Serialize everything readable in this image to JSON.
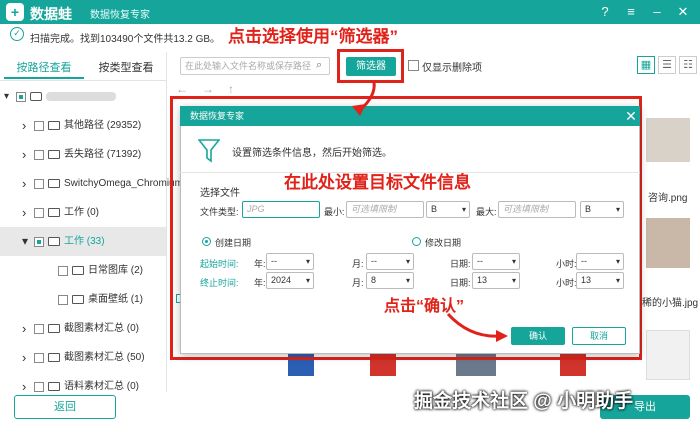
{
  "app": {
    "brand": "数据蛙",
    "product": "数据恢复专家",
    "accent": "#16a59a",
    "annotation_color": "#e0231a"
  },
  "status": {
    "text": "扫描完成。找到103490个文件共13.2 GB。"
  },
  "annotations": {
    "top": "点击选择使用“筛选器”",
    "middle": "在此处设置目标文件信息",
    "confirm": "点击“确认”"
  },
  "tabs": {
    "by_path": "按路径查看",
    "by_type": "按类型查看"
  },
  "toolbar": {
    "search_placeholder": "在此处输入文件名称或保存路径",
    "filter_label": "筛选器",
    "show_deleted_label": "仅显示删除项"
  },
  "tree": [
    {
      "label": "其他路径 (29352)",
      "expanded": false,
      "level": 1
    },
    {
      "label": "丢失路径 (71392)",
      "expanded": false,
      "level": 1
    },
    {
      "label": "SwitchyOmega_Chromium",
      "expanded": false,
      "level": 1
    },
    {
      "label": "工作 (0)",
      "expanded": false,
      "level": 1
    },
    {
      "label": "工作 (33)",
      "expanded": true,
      "level": 1,
      "selected": true
    },
    {
      "label": "日常图库 (2)",
      "level": 2
    },
    {
      "label": "桌面壁纸 (1)",
      "level": 2
    },
    {
      "label": "截图素材汇总 (0)",
      "level": 1
    },
    {
      "label": "截图素材汇总 (50)",
      "level": 1
    },
    {
      "label": "语料素材汇总 (0)",
      "level": 1
    }
  ],
  "right_labels": {
    "label1": "咨询.png",
    "label2": "稀的小猫.jpg"
  },
  "dialog": {
    "title": "数据恢复专家",
    "hint": "设置筛选条件信息，然后开始筛选。",
    "select_file": "选择文件",
    "file_type_label": "文件类型:",
    "file_type_placeholder": "JPG",
    "min_label": "最小:",
    "min_placeholder": "可选填限制",
    "min_unit": "B",
    "max_label": "最大:",
    "max_placeholder": "可选填限制",
    "max_unit": "B",
    "created_label": "创建日期",
    "modified_label": "修改日期",
    "start_label": "起始时间:",
    "end_label": "终止时间:",
    "year_label": "年:",
    "month_label": "月:",
    "day_label": "日期:",
    "hour_label": "小时:",
    "start": {
      "year": "--",
      "month": "--",
      "day": "--",
      "hour": "--"
    },
    "end": {
      "year": "2024",
      "month": "8",
      "day": "13",
      "hour": "13"
    },
    "confirm_label": "确认",
    "cancel_label": "取消"
  },
  "footer": {
    "back_label": "返回",
    "export_label": "导出"
  },
  "watermark": "掘金技术社区 @ 小明助手"
}
